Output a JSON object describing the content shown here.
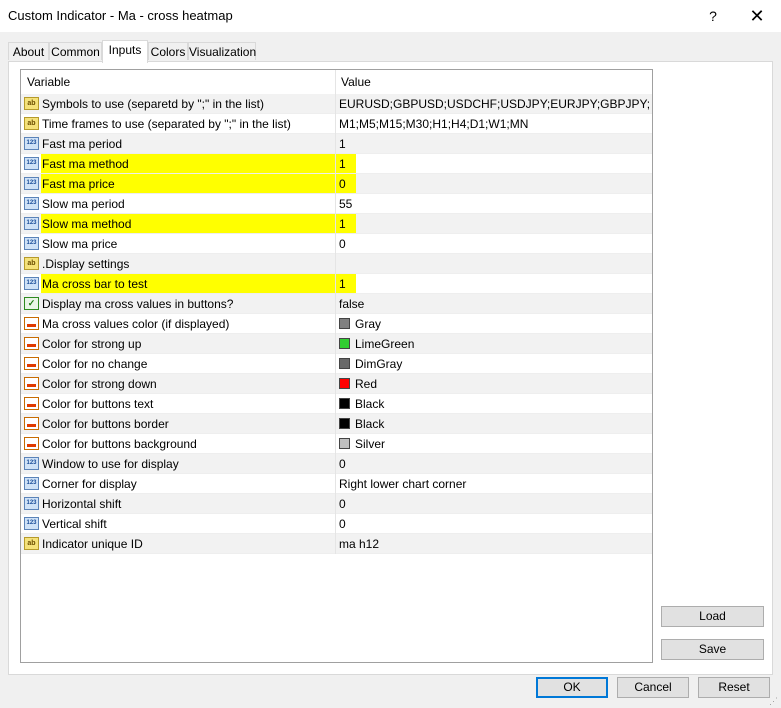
{
  "window": {
    "title": "Custom Indicator - Ma - cross heatmap",
    "help_label": "?",
    "close_label": "✕"
  },
  "tabs": [
    {
      "label": "About"
    },
    {
      "label": "Common"
    },
    {
      "label": "Inputs"
    },
    {
      "label": "Colors"
    },
    {
      "label": "Visualization"
    }
  ],
  "active_tab": "Inputs",
  "grid": {
    "headers": {
      "variable": "Variable",
      "value": "Value"
    },
    "rows": [
      {
        "icon": "ab",
        "variable": "Symbols to use (separetd by \";\" in the list)",
        "value": "EURUSD;GBPUSD;USDCHF;USDJPY;EURJPY;GBPJPY;CHF..."
      },
      {
        "icon": "ab",
        "variable": "Time frames to use (separated by \";\" in the list)",
        "value": "M1;M5;M15;M30;H1;H4;D1;W1;MN"
      },
      {
        "icon": "123",
        "variable": "Fast ma period",
        "value": "1"
      },
      {
        "icon": "123",
        "variable": "Fast ma method",
        "value": "1",
        "highlight": true
      },
      {
        "icon": "123",
        "variable": "Fast ma price",
        "value": "0",
        "highlight": true
      },
      {
        "icon": "123",
        "variable": "Slow ma period",
        "value": "55"
      },
      {
        "icon": "123",
        "variable": "Slow ma method",
        "value": "1",
        "highlight": true
      },
      {
        "icon": "123",
        "variable": "Slow ma price",
        "value": "0"
      },
      {
        "icon": "ab",
        "variable": ".Display settings",
        "value": ""
      },
      {
        "icon": "123",
        "variable": "Ma cross bar to test",
        "value": "1",
        "highlight": true
      },
      {
        "icon": "bool",
        "variable": "Display ma cross values in buttons?",
        "value": "false"
      },
      {
        "icon": "color",
        "variable": "Ma cross values color (if displayed)",
        "value": "Gray",
        "swatch": "#808080"
      },
      {
        "icon": "color",
        "variable": "Color for strong up",
        "value": "LimeGreen",
        "swatch": "#32cd32"
      },
      {
        "icon": "color",
        "variable": "Color for no change",
        "value": "DimGray",
        "swatch": "#696969"
      },
      {
        "icon": "color",
        "variable": "Color for strong down",
        "value": "Red",
        "swatch": "#ff0000"
      },
      {
        "icon": "color",
        "variable": "Color for buttons text",
        "value": "Black",
        "swatch": "#000000"
      },
      {
        "icon": "color",
        "variable": "Color for buttons border",
        "value": "Black",
        "swatch": "#000000"
      },
      {
        "icon": "color",
        "variable": "Color for buttons background",
        "value": "Silver",
        "swatch": "#c0c0c0"
      },
      {
        "icon": "123",
        "variable": "Window to use for display",
        "value": "0"
      },
      {
        "icon": "123",
        "variable": "Corner for display",
        "value": "Right lower chart corner"
      },
      {
        "icon": "123",
        "variable": "Horizontal shift",
        "value": "0"
      },
      {
        "icon": "123",
        "variable": "Vertical shift",
        "value": "0"
      },
      {
        "icon": "ab",
        "variable": "Indicator unique ID",
        "value": "ma h12"
      }
    ]
  },
  "side_buttons": {
    "load": "Load",
    "save": "Save"
  },
  "footer": {
    "ok": "OK",
    "cancel": "Cancel",
    "reset": "Reset"
  },
  "colors": {
    "highlight": "#ffff00",
    "accent": "#0078d7"
  }
}
